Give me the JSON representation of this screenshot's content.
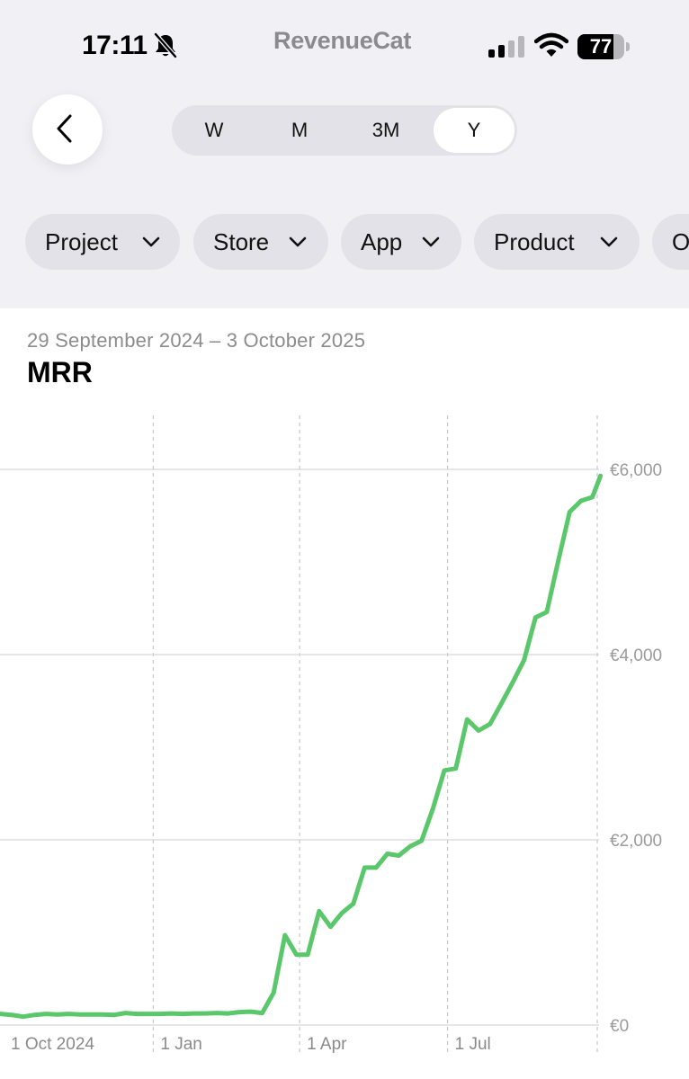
{
  "status_bar": {
    "time": "17:11",
    "carrier_logo": "RevenueCat",
    "battery_percent": 77,
    "icons": [
      "bell-muted-icon",
      "cellular-signal-icon",
      "wifi-icon",
      "battery-icon"
    ]
  },
  "nav": {
    "back_icon": "chevron-left-icon",
    "periods": [
      "W",
      "M",
      "3M",
      "Y"
    ],
    "selected_period": "Y"
  },
  "filters": [
    {
      "label": "Project"
    },
    {
      "label": "Store"
    },
    {
      "label": "App"
    },
    {
      "label": "Product"
    },
    {
      "label": "O"
    }
  ],
  "header": {
    "date_range": "29 September 2024 – 3 October 2025",
    "metric": "MRR"
  },
  "colors": {
    "line": "#5ac76b",
    "grid": "#d6d6d6",
    "top_background": "#f1f0f5",
    "chip_background": "#e3e2e8"
  },
  "chart_data": {
    "type": "line",
    "x_range": [
      "2024-09-29",
      "2025-10-03"
    ],
    "ylim": [
      0,
      6500
    ],
    "y_ticks": [
      {
        "value": 0,
        "label": "€0"
      },
      {
        "value": 2000,
        "label": "€2,000"
      },
      {
        "value": 4000,
        "label": "€4,000"
      },
      {
        "value": 6000,
        "label": "€6,000"
      }
    ],
    "x_ticks": [
      {
        "date": "2024-10-01",
        "label": "1 Oct 2024"
      },
      {
        "date": "2025-01-01",
        "label": "1 Jan"
      },
      {
        "date": "2025-04-01",
        "label": "1 Apr"
      },
      {
        "date": "2025-07-01",
        "label": "1 Jul"
      },
      {
        "date": "2025-10-01",
        "label": ""
      }
    ],
    "grid": {
      "horizontal": true,
      "vertical_dashed": true
    },
    "series": [
      {
        "x": [
          "2024-09-29",
          "2024-10-06",
          "2024-10-13",
          "2024-10-20",
          "2024-10-27",
          "2024-11-03",
          "2024-11-10",
          "2024-11-17",
          "2024-11-24",
          "2024-12-01",
          "2024-12-08",
          "2024-12-15",
          "2024-12-22",
          "2024-12-29",
          "2025-01-05",
          "2025-01-12",
          "2025-01-19",
          "2025-01-26",
          "2025-02-02",
          "2025-02-09",
          "2025-02-16",
          "2025-02-23",
          "2025-03-02",
          "2025-03-09",
          "2025-03-16",
          "2025-03-23",
          "2025-03-30",
          "2025-04-06",
          "2025-04-13",
          "2025-04-20",
          "2025-04-27",
          "2025-05-04",
          "2025-05-11",
          "2025-05-18",
          "2025-05-25",
          "2025-06-01",
          "2025-06-08",
          "2025-06-15",
          "2025-06-22",
          "2025-06-29",
          "2025-07-06",
          "2025-07-13",
          "2025-07-20",
          "2025-07-27",
          "2025-08-03",
          "2025-08-10",
          "2025-08-17",
          "2025-08-24",
          "2025-08-31",
          "2025-09-07",
          "2025-09-14",
          "2025-09-21",
          "2025-09-28",
          "2025-10-03"
        ],
        "values": [
          120,
          110,
          90,
          110,
          120,
          115,
          120,
          115,
          115,
          115,
          110,
          130,
          120,
          120,
          120,
          125,
          120,
          125,
          125,
          130,
          125,
          140,
          145,
          130,
          350,
          970,
          760,
          760,
          1230,
          1060,
          1210,
          1310,
          1700,
          1700,
          1850,
          1830,
          1930,
          1990,
          2340,
          2750,
          2770,
          3300,
          3180,
          3250,
          3470,
          3700,
          3940,
          4400,
          4460,
          5010,
          5540,
          5660,
          5700,
          5930
        ]
      }
    ]
  }
}
